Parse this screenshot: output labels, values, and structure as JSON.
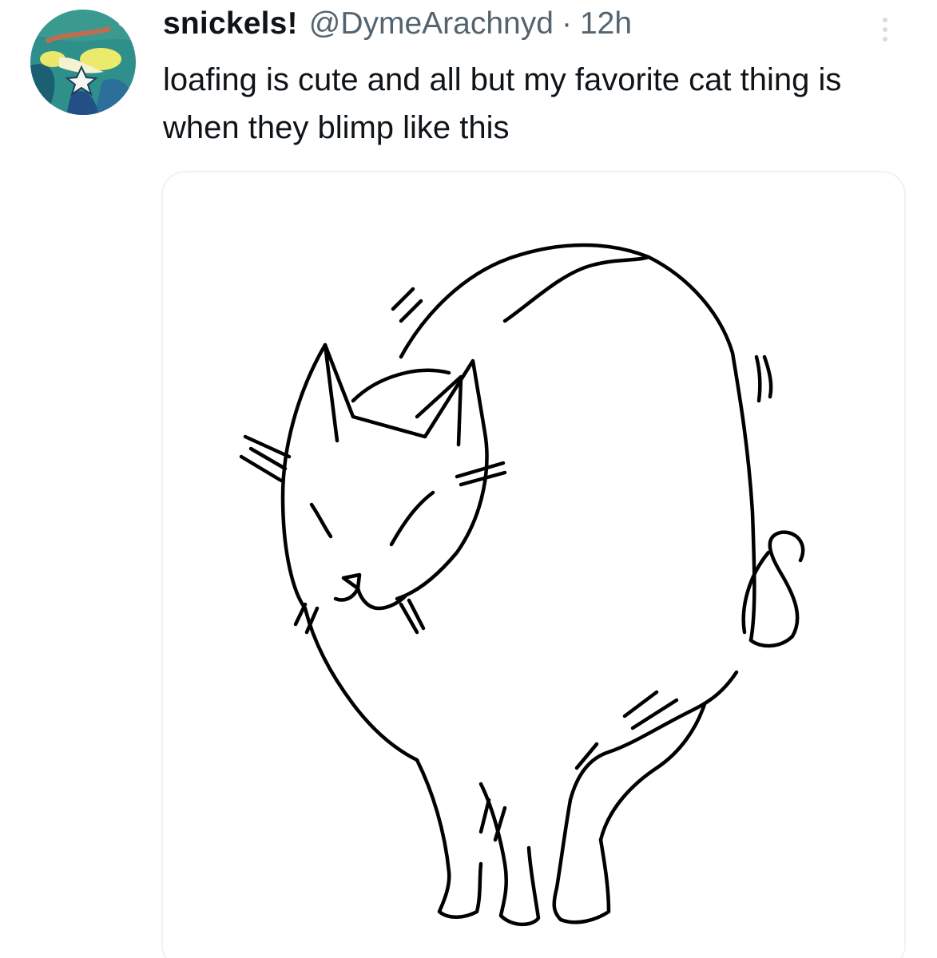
{
  "tweet": {
    "display_name": "snickels!",
    "handle": "@DymeArachnyd",
    "separator": "·",
    "timestamp": "12h",
    "text": "loafing is cute and all but my favorite cat thing is when they blimp like this",
    "avatar_icon": "illustrated-character-avatar",
    "more_icon": "more-vertical-icon",
    "media_icon": "cat-line-drawing"
  },
  "colors": {
    "text_primary": "#0f1419",
    "text_secondary": "#536471",
    "card_border": "#eff3f4",
    "background": "#ffffff"
  }
}
